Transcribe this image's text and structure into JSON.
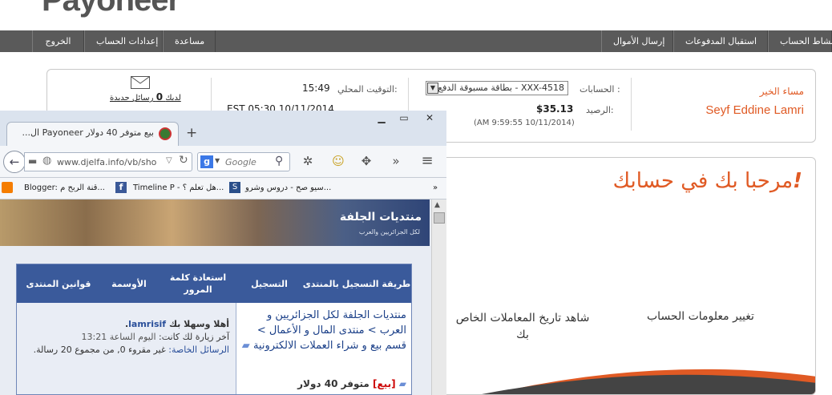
{
  "payoneer": {
    "logo_text": "Payoneer",
    "nav_right": [
      "نشاط الحساب",
      "استقبال المدفوعات",
      "إرسال الأموال"
    ],
    "nav_left": [
      "مساعدة",
      "إعدادات الحساب",
      "الخروج"
    ],
    "greeting": "مساء الخير",
    "user_name": "Seyf Eddine Lamri",
    "accounts_label": "الحسابات :",
    "account_select": "بطاقة مسبوقة الدفع - XXX-4518",
    "balance_label": "الرصيد:",
    "balance": "$35.13",
    "balance_time": "(AM 9:59:55 10/11/2014)",
    "local_time_label": "التوقيت المحلي:",
    "local_time": "15:49",
    "est_time": "EST 05:30 10/11/2014",
    "messages_line1": "لديك",
    "messages_count": "0",
    "messages_line2": "رسائل جديدة",
    "welcome_heading": "مرحبا بك في حسابك",
    "welcome_exclaim": "!",
    "change_info": "تغيير معلومات الحساب",
    "view_history": "شاهد تاريخ المعاملات الخاص بك",
    "accent_color": "#e05a24"
  },
  "browser": {
    "tab_title": "...ال Payoneer بيع متوفر 40 دولار",
    "new_tab": "+",
    "url": "www.djelfa.info/vb/sho",
    "search_engine": "Google",
    "bookmarks": [
      "Blogger: قنة الربح م...",
      "Timeline P - هل تعلم ؟...",
      "سيو صح - دروس وشرو..."
    ],
    "overflow": "»"
  },
  "forum": {
    "banner_text": "منتديات الجلفة",
    "banner_sub": "لكل الجزائريين والعرب",
    "headers": [
      "طريقة التسجيل بالمنتدى",
      "التسجيل",
      "استعادة كلمة المرور",
      "الأوسمة",
      "قوانين المنتدى"
    ],
    "breadcrumb": "منتديات الجلفة لكل الجزائريين و العرب > منتدى المال و الأعمال > قسم بيع و شراء العملات الالكترونية",
    "thread_tag": "[بيع]",
    "thread_title": "متوفر 40 دولار",
    "welcome_prefix": "أهلا وسهلا بك",
    "username": "lamrisif",
    "last_visit_label": "آخر زيارة لك كانت:",
    "last_visit_value": "اليوم الساعة 13:21",
    "pm_label": "الرسائل الخاصة:",
    "pm_value": "غير مقروء 0, من مجموع 20 رسالة."
  }
}
